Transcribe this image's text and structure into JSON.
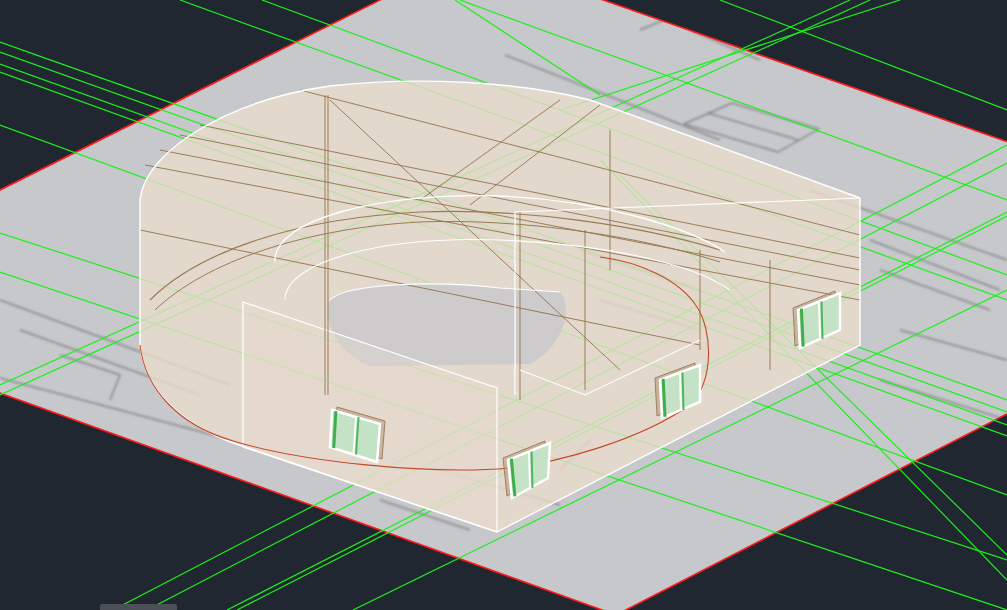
{
  "viewport": {
    "kind": "model",
    "windows": [
      {
        "kind": "sliding"
      },
      {
        "kind": "sliding"
      },
      {
        "kind": "sliding"
      },
      {
        "kind": "sliding"
      }
    ]
  }
}
